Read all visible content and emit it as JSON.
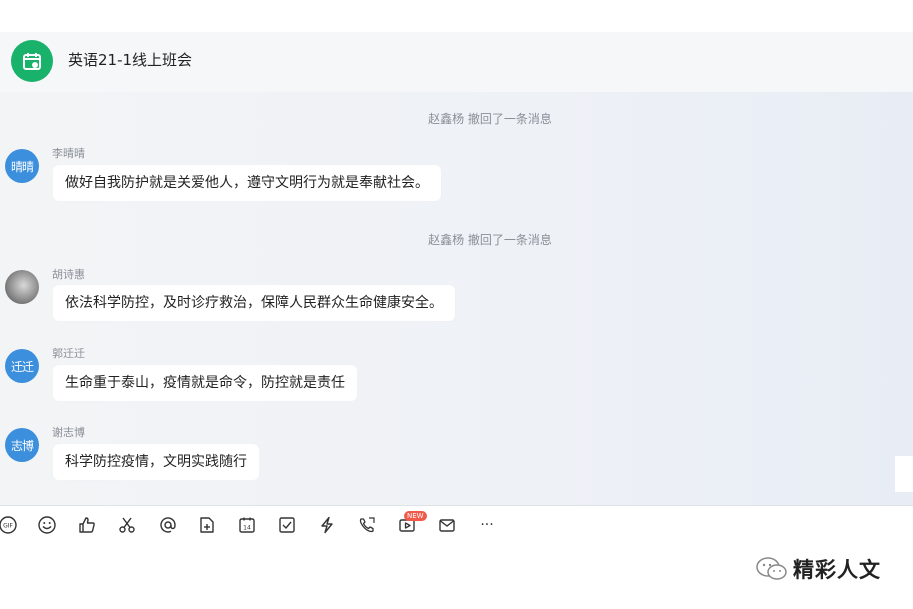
{
  "header": {
    "title": "英语21-1线上班会"
  },
  "messages": [
    {
      "type": "notice",
      "text": "赵鑫杨 撤回了一条消息"
    },
    {
      "type": "msg",
      "sender": "李晴晴",
      "avatar_text": "晴晴",
      "text": "做好自我防护就是关爱他人，遵守文明行为就是奉献社会。"
    },
    {
      "type": "notice",
      "text": "赵鑫杨 撤回了一条消息"
    },
    {
      "type": "msg",
      "sender": "胡诗惠",
      "avatar_text": "",
      "text": "依法科学防控，及时诊疗救治，保障人民群众生命健康安全。"
    },
    {
      "type": "msg",
      "sender": "郭迁迁",
      "avatar_text": "迁迁",
      "text": "生命重于泰山，疫情就是命令，防控就是责任"
    },
    {
      "type": "msg",
      "sender": "谢志博",
      "avatar_text": "志博",
      "text": "科学防控疫情，文明实践随行"
    }
  ],
  "toolbar": {
    "icons": [
      "gif-icon",
      "emoji-icon",
      "thumbs-up-icon",
      "scissors-icon",
      "at-icon",
      "file-add-icon",
      "calendar-icon",
      "checkbox-icon",
      "lightning-icon",
      "phone-icon",
      "video-icon",
      "mail-icon",
      "more-icon"
    ],
    "gif_label": "GIF",
    "calendar_label": "14",
    "new_badge": "NEW",
    "more_label": "···"
  },
  "watermark": {
    "text": "精彩人文"
  },
  "colors": {
    "group_avatar": "#18b26b",
    "avatar": "#3b8fdc",
    "badge": "#f05a4a"
  }
}
